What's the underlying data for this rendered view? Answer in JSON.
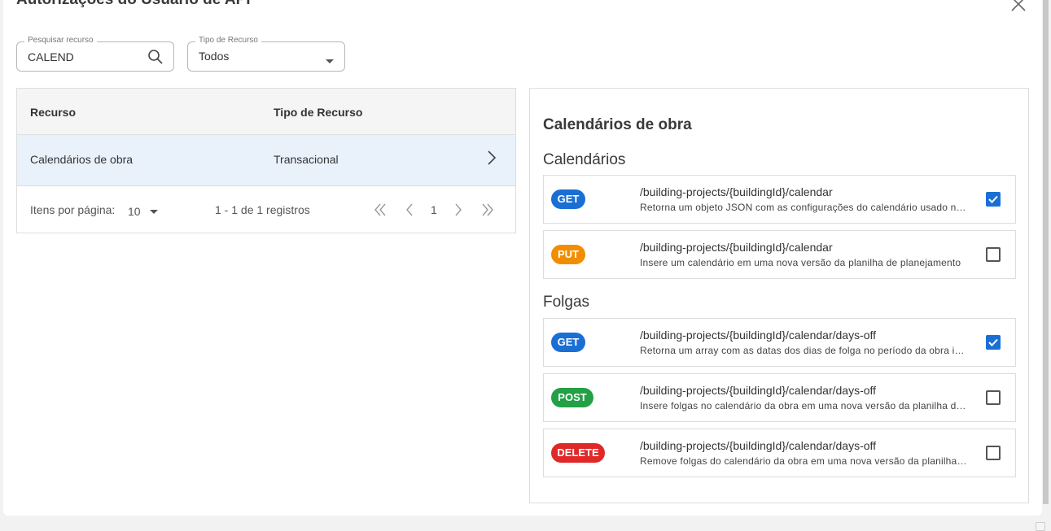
{
  "dialog": {
    "title": "Autorizações do Usuário de API"
  },
  "filters": {
    "search": {
      "label": "Pesquisar recurso",
      "value": "CALEND"
    },
    "type": {
      "label": "Tipo de Recurso",
      "value": "Todos"
    }
  },
  "table": {
    "headers": {
      "resource": "Recurso",
      "type": "Tipo de Recurso"
    },
    "rows": [
      {
        "resource": "Calendários de obra",
        "type": "Transacional"
      }
    ],
    "paginator": {
      "items_label": "Itens por página:",
      "page_size": "10",
      "range": "1 - 1 de 1 registros",
      "current_page": "1"
    }
  },
  "detail": {
    "title": "Calendários de obra",
    "sections": [
      {
        "title": "Calendários",
        "endpoints": [
          {
            "method": "GET",
            "path": "/building-projects/{buildingId}/calendar",
            "description": "Retorna um objeto JSON com as configurações do calendário usado na obra",
            "checked": true
          },
          {
            "method": "PUT",
            "path": "/building-projects/{buildingId}/calendar",
            "description": "Insere um calendário em uma nova versão da planilha de planejamento",
            "checked": false
          }
        ]
      },
      {
        "title": "Folgas",
        "endpoints": [
          {
            "method": "GET",
            "path": "/building-projects/{buildingId}/calendar/days-off",
            "description": "Retorna um array com as datas dos dias de folga no período da obra informado",
            "checked": true
          },
          {
            "method": "POST",
            "path": "/building-projects/{buildingId}/calendar/days-off",
            "description": "Insere folgas no calendário da obra em uma nova versão da planilha de planejamento",
            "checked": false
          },
          {
            "method": "DELETE",
            "path": "/building-projects/{buildingId}/calendar/days-off",
            "description": "Remove folgas do calendário da obra em uma nova versão da planilha de planejamento",
            "checked": false
          }
        ]
      }
    ]
  },
  "colors": {
    "GET": "#1a6fd4",
    "PUT": "#f28c00",
    "POST": "#22a045",
    "DELETE": "#e02828",
    "row_selected": "#e9f1fb",
    "checkbox_checked": "#1a6fd4"
  }
}
